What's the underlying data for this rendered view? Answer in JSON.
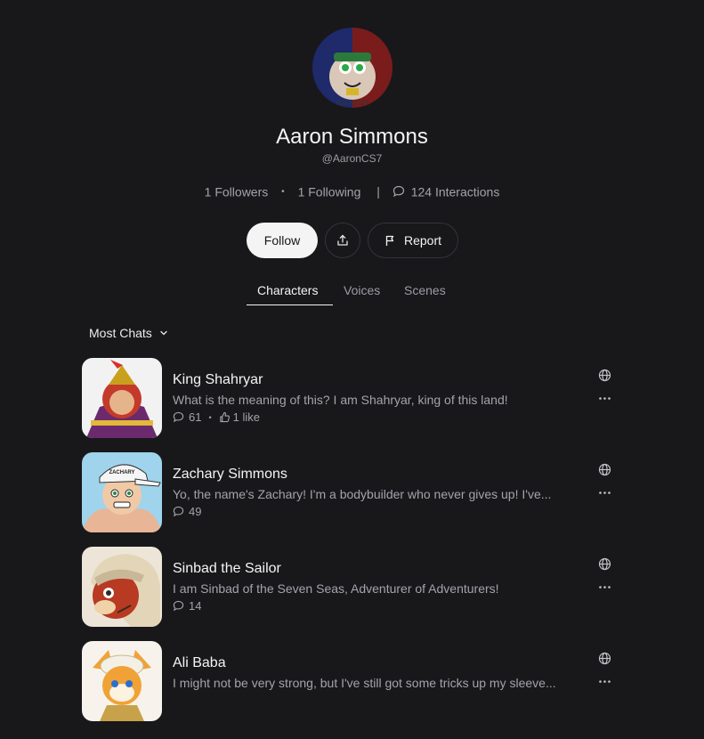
{
  "profile": {
    "avatar_caption": "AaronCS7",
    "name": "Aaron Simmons",
    "handle": "@AaronCS7",
    "followers": "1 Followers",
    "following": "1 Following",
    "interactions": "124 Interactions"
  },
  "actions": {
    "follow_label": "Follow",
    "report_label": "Report"
  },
  "tabs": [
    {
      "label": "Characters",
      "active": true
    },
    {
      "label": "Voices",
      "active": false
    },
    {
      "label": "Scenes",
      "active": false
    }
  ],
  "sort": {
    "label": "Most Chats"
  },
  "characters": [
    {
      "name": "King Shahryar",
      "description": "What is the meaning of this? I am Shahryar, king of this land!",
      "chats": "61",
      "likes": "1 like"
    },
    {
      "name": "Zachary Simmons",
      "description": "Yo, the name's Zachary! I'm a bodybuilder who never gives up! I've...",
      "chats": "49"
    },
    {
      "name": "Sinbad the Sailor",
      "description": "I am Sinbad of the Seven Seas, Adventurer of Adventurers!",
      "chats": "14"
    },
    {
      "name": "Ali Baba",
      "description": "I might not be very strong, but I've still got some tricks up my sleeve..."
    }
  ],
  "colors": {
    "background": "#18181b",
    "text": "#f4f4f5",
    "muted": "#a3a3aa"
  }
}
